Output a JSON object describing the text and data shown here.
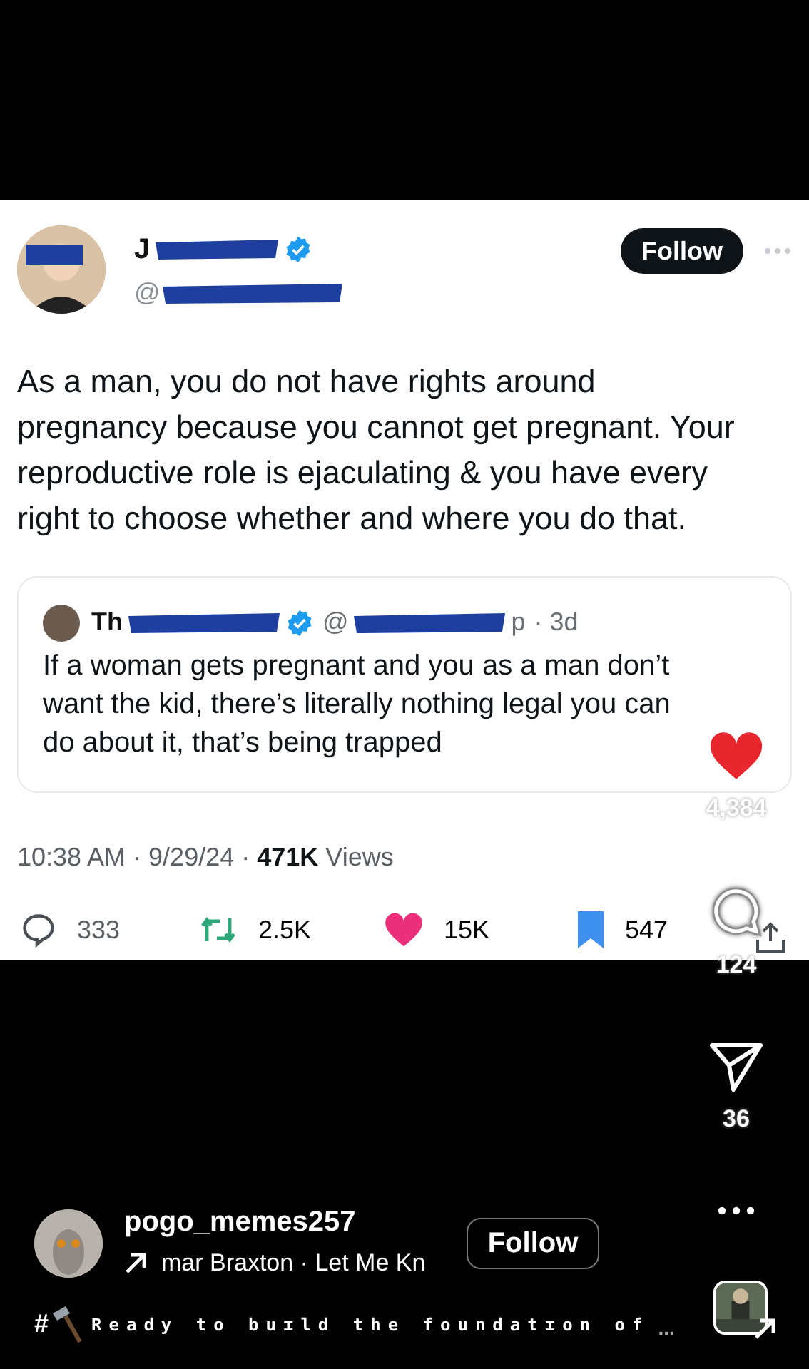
{
  "tweet": {
    "author": {
      "name": "J",
      "handle": "@",
      "verified": true
    },
    "follow_button": "Follow",
    "text": "As a man, you do not have rights around pregnancy because you cannot get pregnant. Your reproductive role is ejaculating & you have every right to choose whether and where you do that.",
    "quote": {
      "name": "Th",
      "verified": true,
      "handle": "@",
      "handle_end": "p",
      "time": "· 3d",
      "text": "If a woman gets pregnant and you as a man don’t want the kid, there’s literally nothing legal you can do about it, that’s being trapped"
    },
    "timestamp": "10:38 AM · 9/29/24 · **471K** Views",
    "stats": [
      {
        "kind": "reply",
        "count": "333"
      },
      {
        "kind": "retweet",
        "count": "2.5K"
      },
      {
        "kind": "like",
        "count": "15K"
      },
      {
        "kind": "bookmark",
        "count": "547"
      },
      {
        "kind": "share"
      }
    ]
  },
  "reel": {
    "actions": [
      {
        "kind": "like",
        "count": "4,384",
        "liked": true
      },
      {
        "kind": "comment",
        "count": "124"
      },
      {
        "kind": "send",
        "count": "36"
      },
      {
        "kind": "more"
      }
    ],
    "username": "pogo_memes257",
    "audio": "mar Braxton · Let Me Kn",
    "follow_button": "Follow",
    "caption_tag": "#",
    "caption": "Ready to buɪld the foundatɪon of",
    "caption_more": "..."
  }
}
